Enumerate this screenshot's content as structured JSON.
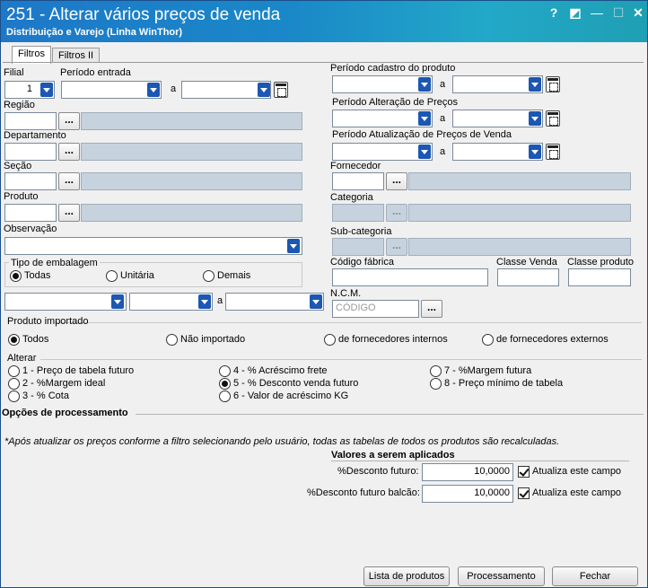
{
  "window": {
    "title": "251 - Alterar vários preços de venda",
    "subtitle": "Distribuição e Varejo (Linha WinThor)",
    "help_glyph": "?",
    "theme_glyph": "◩",
    "minimize_glyph": "—",
    "maximize_glyph": "☐",
    "close_glyph": "✕"
  },
  "tabs": [
    {
      "label": "Filtros"
    },
    {
      "label": "Filtros II"
    }
  ],
  "filters": {
    "filial_label": "Filial",
    "filial_value": "1",
    "periodo_entrada_label": "Período entrada",
    "a_label": "a",
    "regiao_label": "Região",
    "departamento_label": "Departamento",
    "secao_label": "Seção",
    "produto_label": "Produto",
    "observacao_label": "Observação",
    "tipo_embalagem_label": "Tipo de embalagem",
    "embalagem_options": [
      "Todas",
      "Unitária",
      "Demais"
    ],
    "periodo_cadastro_label": "Período cadastro do produto",
    "periodo_alteracao_label": "Período Alteração de Preços",
    "periodo_atualizacao_label": "Período Atualização de Preços de Venda",
    "fornecedor_label": "Fornecedor",
    "categoria_label": "Categoria",
    "subcategoria_label": "Sub-categoria",
    "codigo_fabrica_label": "Código fábrica",
    "classe_venda_label": "Classe Venda",
    "classe_produto_label": "Classe produto",
    "ncm_label": "N.C.M.",
    "ncm_placeholder": "CÓDIGO",
    "dots": "...",
    "produto_importado_label": "Produto importado",
    "importado_options": [
      "Todos",
      "Não importado",
      "de fornecedores internos",
      "de fornecedores externos"
    ],
    "alterar_label": "Alterar",
    "alterar_options": [
      "1 - Preço de tabela futuro",
      "2 - %Margem ideal",
      "3 - % Cota",
      "4 - % Acréscimo frete",
      "5 - % Desconto venda futuro",
      "6 - Valor de acréscimo KG",
      "7 - %Margem futura",
      "8 - Preço mínimo de tabela"
    ],
    "alterar_selected": 4
  },
  "processing": {
    "title": "Opções de processamento",
    "note": "*Após atualizar os preços conforme a filtro selecionando pelo usuário, todas as tabelas de todos os produtos são recalculadas.",
    "values_title": "Valores a serem aplicados",
    "desconto_futuro_label": "%Desconto futuro:",
    "desconto_futuro_value": "10,0000",
    "desconto_balcao_label": "%Desconto futuro balcão:",
    "desconto_balcao_value": "10,0000",
    "atualiza_label": "Atualiza este campo"
  },
  "buttons": {
    "lista_produtos": "Lista de produtos",
    "processamento": "Processamento",
    "fechar": "Fechar"
  }
}
